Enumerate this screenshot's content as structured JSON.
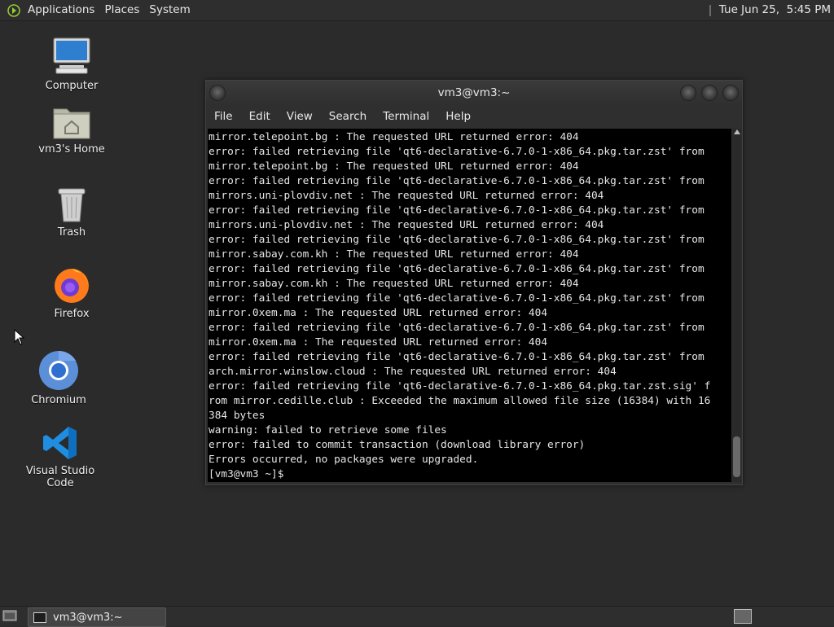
{
  "top_panel": {
    "menus": [
      "Applications",
      "Places",
      "System"
    ],
    "clock": "Tue Jun 25,  5:45 PM"
  },
  "desktop_icons": [
    {
      "label": "Computer",
      "icon": "computer-icon"
    },
    {
      "label": "vm3's Home",
      "icon": "home-folder-icon"
    },
    {
      "label": "Trash",
      "icon": "trash-icon"
    },
    {
      "label": "Firefox",
      "icon": "firefox-icon"
    },
    {
      "label": "Chromium",
      "icon": "chromium-icon"
    },
    {
      "label": "Visual Studio Code",
      "icon": "vscode-icon"
    }
  ],
  "terminal": {
    "title": "vm3@vm3:~",
    "menu": [
      "File",
      "Edit",
      "View",
      "Search",
      "Terminal",
      "Help"
    ],
    "lines": [
      "mirror.telepoint.bg : The requested URL returned error: 404",
      "error: failed retrieving file 'qt6-declarative-6.7.0-1-x86_64.pkg.tar.zst' from",
      "mirror.telepoint.bg : The requested URL returned error: 404",
      "error: failed retrieving file 'qt6-declarative-6.7.0-1-x86_64.pkg.tar.zst' from",
      "mirrors.uni-plovdiv.net : The requested URL returned error: 404",
      "error: failed retrieving file 'qt6-declarative-6.7.0-1-x86_64.pkg.tar.zst' from",
      "mirrors.uni-plovdiv.net : The requested URL returned error: 404",
      "error: failed retrieving file 'qt6-declarative-6.7.0-1-x86_64.pkg.tar.zst' from",
      "mirror.sabay.com.kh : The requested URL returned error: 404",
      "error: failed retrieving file 'qt6-declarative-6.7.0-1-x86_64.pkg.tar.zst' from",
      "mirror.sabay.com.kh : The requested URL returned error: 404",
      "error: failed retrieving file 'qt6-declarative-6.7.0-1-x86_64.pkg.tar.zst' from",
      "mirror.0xem.ma : The requested URL returned error: 404",
      "error: failed retrieving file 'qt6-declarative-6.7.0-1-x86_64.pkg.tar.zst' from",
      "mirror.0xem.ma : The requested URL returned error: 404",
      "error: failed retrieving file 'qt6-declarative-6.7.0-1-x86_64.pkg.tar.zst' from",
      "arch.mirror.winslow.cloud : The requested URL returned error: 404",
      "error: failed retrieving file 'qt6-declarative-6.7.0-1-x86_64.pkg.tar.zst.sig' f",
      "rom mirror.cedille.club : Exceeded the maximum allowed file size (16384) with 16",
      "384 bytes",
      "warning: failed to retrieve some files",
      "error: failed to commit transaction (download library error)",
      "Errors occurred, no packages were upgraded.",
      "[vm3@vm3 ~]$ "
    ]
  },
  "bottom_panel": {
    "task_label": "vm3@vm3:~"
  }
}
